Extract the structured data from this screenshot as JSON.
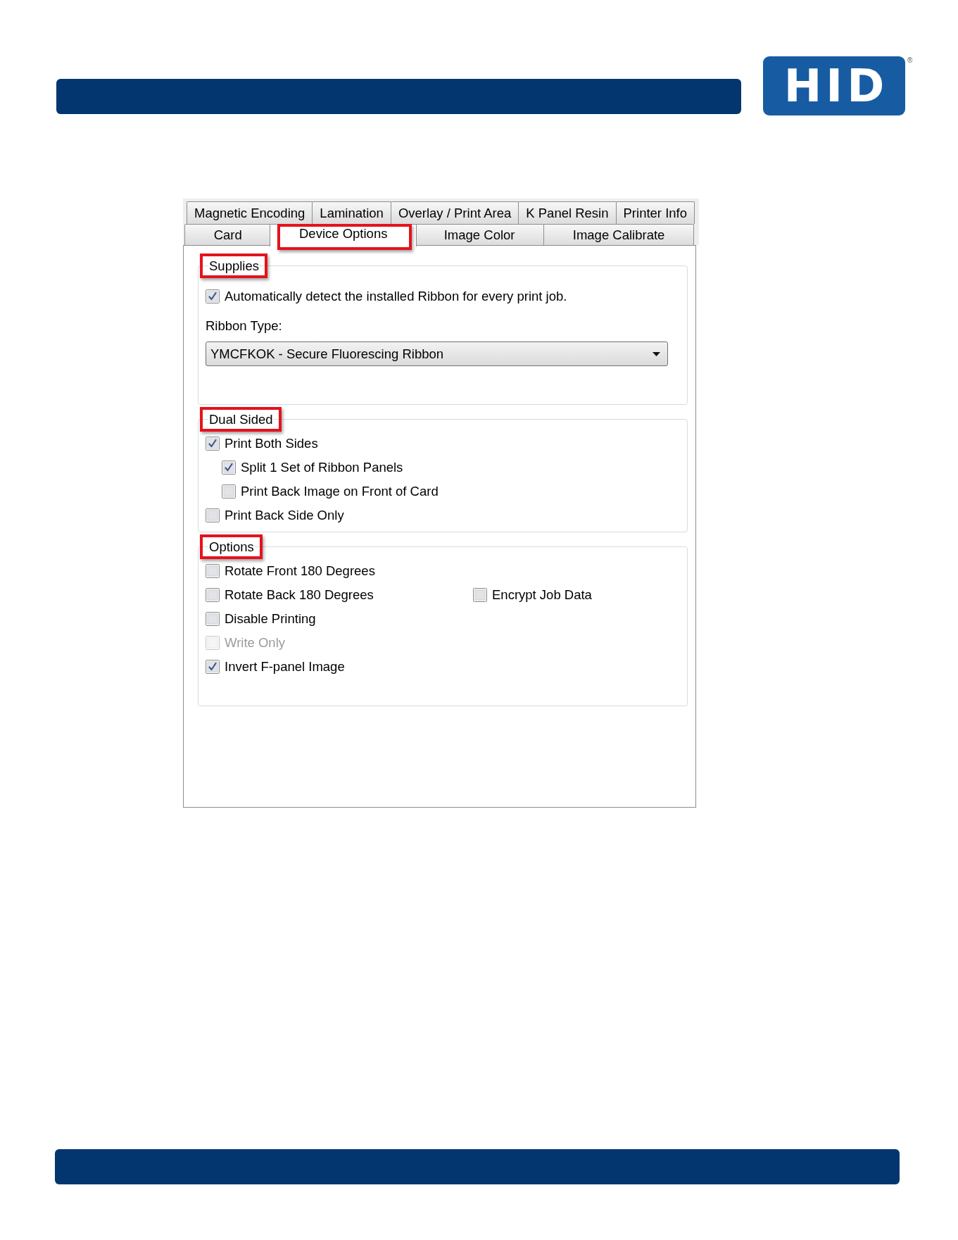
{
  "logo": {
    "text": "HID",
    "registered_mark": "®"
  },
  "tabs": {
    "rows": [
      [
        {
          "label": "Magnetic Encoding",
          "selected": false,
          "highlighted": false
        },
        {
          "label": "Lamination",
          "selected": false,
          "highlighted": false
        },
        {
          "label": "Overlay / Print Area",
          "selected": false,
          "highlighted": false
        },
        {
          "label": "K Panel Resin",
          "selected": false,
          "highlighted": false
        },
        {
          "label": "Printer Info",
          "selected": false,
          "highlighted": false
        }
      ],
      [
        {
          "label": "Card",
          "selected": false,
          "highlighted": false
        },
        {
          "label": "Device Options",
          "selected": true,
          "highlighted": true
        },
        {
          "label": "Image Color",
          "selected": false,
          "highlighted": false
        },
        {
          "label": "Image Calibrate",
          "selected": false,
          "highlighted": false
        }
      ]
    ]
  },
  "supplies": {
    "title": "Supplies",
    "highlighted": true,
    "auto_detect": {
      "label": "Automatically detect the installed Ribbon for every print job.",
      "checked": true,
      "disabled": false
    },
    "ribbon_type": {
      "label": "Ribbon Type:",
      "value": "YMCFKOK - Secure Fluorescing Ribbon"
    }
  },
  "dual_sided": {
    "title": "Dual Sided",
    "highlighted": true,
    "items": [
      {
        "label": "Print Both Sides",
        "checked": true,
        "disabled": false,
        "children": [
          {
            "label": "Split 1 Set of Ribbon Panels",
            "checked": true,
            "disabled": false
          },
          {
            "label": "Print Back Image on Front of Card",
            "checked": false,
            "disabled": false
          }
        ]
      },
      {
        "label": "Print Back Side Only",
        "checked": false,
        "disabled": false
      }
    ]
  },
  "options": {
    "title": "Options",
    "highlighted": true,
    "rows": [
      {
        "items": [
          {
            "label": "Rotate Front 180 Degrees",
            "checked": false,
            "disabled": false
          }
        ]
      },
      {
        "items": [
          {
            "label": "Rotate Back 180 Degrees",
            "checked": false,
            "disabled": false
          },
          {
            "label": "Encrypt Job Data",
            "checked": false,
            "disabled": false
          }
        ]
      },
      {
        "items": [
          {
            "label": "Disable Printing",
            "checked": false,
            "disabled": false
          }
        ]
      },
      {
        "items": [
          {
            "label": "Write Only",
            "checked": false,
            "disabled": true
          }
        ]
      },
      {
        "items": [
          {
            "label": "Invert F-panel Image",
            "checked": true,
            "disabled": false
          }
        ]
      }
    ]
  }
}
